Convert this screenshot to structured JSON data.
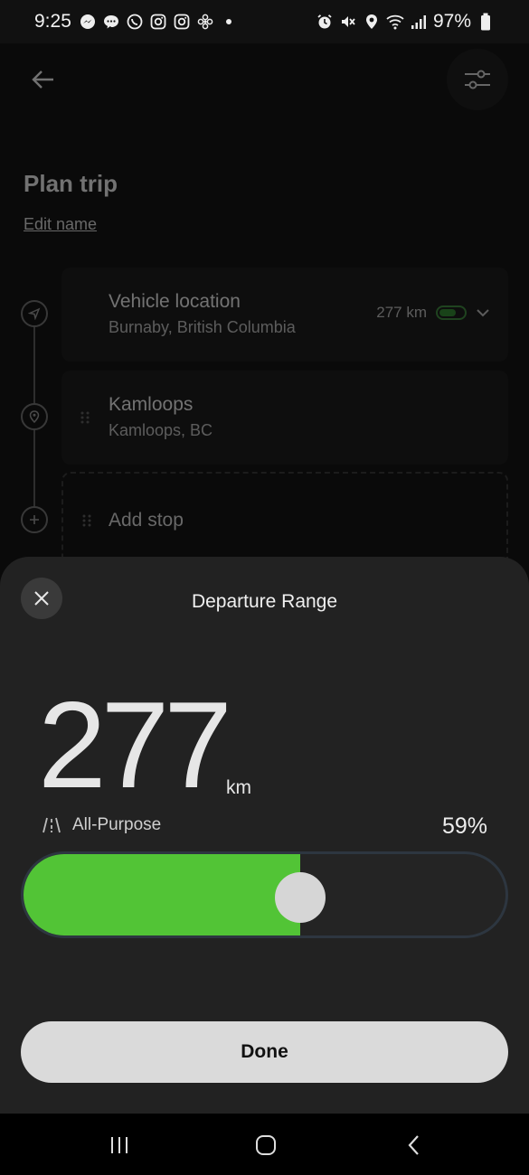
{
  "status_bar": {
    "time": "9:25",
    "battery": "97%",
    "left_icons": [
      "messenger-icon",
      "chat-icon",
      "whatsapp-icon",
      "instagram-icon",
      "instagram-icon",
      "fan-icon",
      "dot-icon"
    ],
    "right_icons": [
      "alarm-icon",
      "mute-icon",
      "location-icon",
      "wifi-icon",
      "signal-icon",
      "battery-icon"
    ]
  },
  "page": {
    "title": "Plan trip",
    "edit_label": "Edit name",
    "stops": [
      {
        "name": "Vehicle location",
        "sub": "Burnaby, British Columbia",
        "range": "277 km"
      },
      {
        "name": "Kamloops",
        "sub": "Kamloops, BC"
      }
    ],
    "add_stop_label": "Add stop"
  },
  "sheet": {
    "title": "Departure Range",
    "range_value": "277",
    "range_unit": "km",
    "mode_label": "All-Purpose",
    "percent_label": "59%",
    "charge_fraction": 0.575,
    "done_label": "Done"
  },
  "colors": {
    "accent_green": "#52c436",
    "sheet_bg": "#222222",
    "button_bg": "#dadada"
  }
}
